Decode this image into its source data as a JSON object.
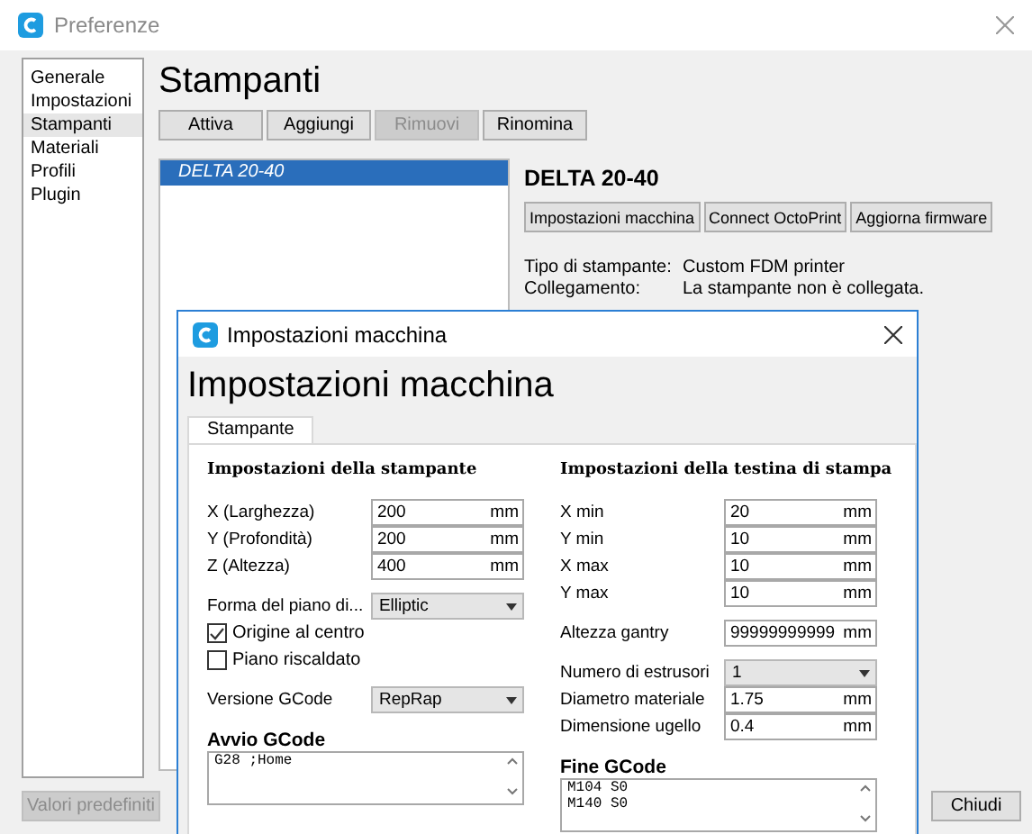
{
  "window": {
    "title": "Preferenze"
  },
  "sidebar": {
    "items": [
      {
        "label": "Generale",
        "selected": false
      },
      {
        "label": "Impostazioni",
        "selected": false
      },
      {
        "label": "Stampanti",
        "selected": true
      },
      {
        "label": "Materiali",
        "selected": false
      },
      {
        "label": "Profili",
        "selected": false
      },
      {
        "label": "Plugin",
        "selected": false
      }
    ]
  },
  "page": {
    "title": "Stampanti",
    "buttons": [
      {
        "label": "Attiva",
        "disabled": false
      },
      {
        "label": "Aggiungi",
        "disabled": false
      },
      {
        "label": "Rimuovi",
        "disabled": true
      },
      {
        "label": "Rinomina",
        "disabled": false
      }
    ]
  },
  "printers": [
    {
      "name": "DELTA 20-40",
      "selected": true
    }
  ],
  "printer_detail": {
    "name": "DELTA 20-40",
    "buttons": [
      "Impostazioni macchina",
      "Connect OctoPrint",
      "Aggiorna firmware"
    ],
    "info": [
      {
        "label": "Tipo di stampante:",
        "value": "Custom FDM printer"
      },
      {
        "label": "Collegamento:",
        "value": "La stampante non è collegata."
      }
    ]
  },
  "footer": {
    "defaults_button": {
      "label": "Valori predefiniti",
      "disabled": true
    },
    "close_button": {
      "label": "Chiudi",
      "disabled": false
    }
  },
  "dialog": {
    "title": "Impostazioni macchina",
    "heading": "Impostazioni macchina",
    "tabs": [
      {
        "label": "Stampante",
        "selected": true
      }
    ],
    "left": {
      "heading": "Impostazioni della stampante",
      "groups": [
        [
          {
            "kind": "input",
            "label": "X (Larghezza)",
            "value": "200",
            "unit": "mm"
          },
          {
            "kind": "input",
            "label": "Y (Profondità)",
            "value": "200",
            "unit": "mm"
          },
          {
            "kind": "input",
            "label": "Z (Altezza)",
            "value": "400",
            "unit": "mm"
          }
        ],
        [
          {
            "kind": "select",
            "label": "Forma del piano di...",
            "value": "Elliptic"
          },
          {
            "kind": "checkbox",
            "label": "Origine al centro",
            "checked": true
          },
          {
            "kind": "checkbox",
            "label": "Piano riscaldato",
            "checked": false
          }
        ],
        [
          {
            "kind": "select",
            "label": "Versione GCode",
            "value": "RepRap"
          }
        ]
      ]
    },
    "right": {
      "heading": "Impostazioni della testina di stampa",
      "groups": [
        [
          {
            "kind": "input",
            "label": "X min",
            "value": "20",
            "unit": "mm"
          },
          {
            "kind": "input",
            "label": "Y min",
            "value": "10",
            "unit": "mm"
          },
          {
            "kind": "input",
            "label": "X max",
            "value": "10",
            "unit": "mm"
          },
          {
            "kind": "input",
            "label": "Y max",
            "value": "10",
            "unit": "mm"
          }
        ],
        [
          {
            "kind": "input",
            "label": "Altezza gantry",
            "value": "99999999999",
            "unit": "mm"
          }
        ],
        [
          {
            "kind": "select",
            "label": "Numero di estrusori",
            "value": "1"
          },
          {
            "kind": "input",
            "label": "Diametro materiale",
            "value": "1.75",
            "unit": "mm"
          },
          {
            "kind": "input",
            "label": "Dimensione ugello",
            "value": "0.4",
            "unit": "mm"
          }
        ]
      ]
    },
    "start_gcode": {
      "title": "Avvio GCode",
      "lines": [
        "G28 ;Home"
      ]
    },
    "end_gcode": {
      "title": "Fine GCode",
      "lines": [
        "M104 S0",
        "M140 S0"
      ]
    }
  }
}
